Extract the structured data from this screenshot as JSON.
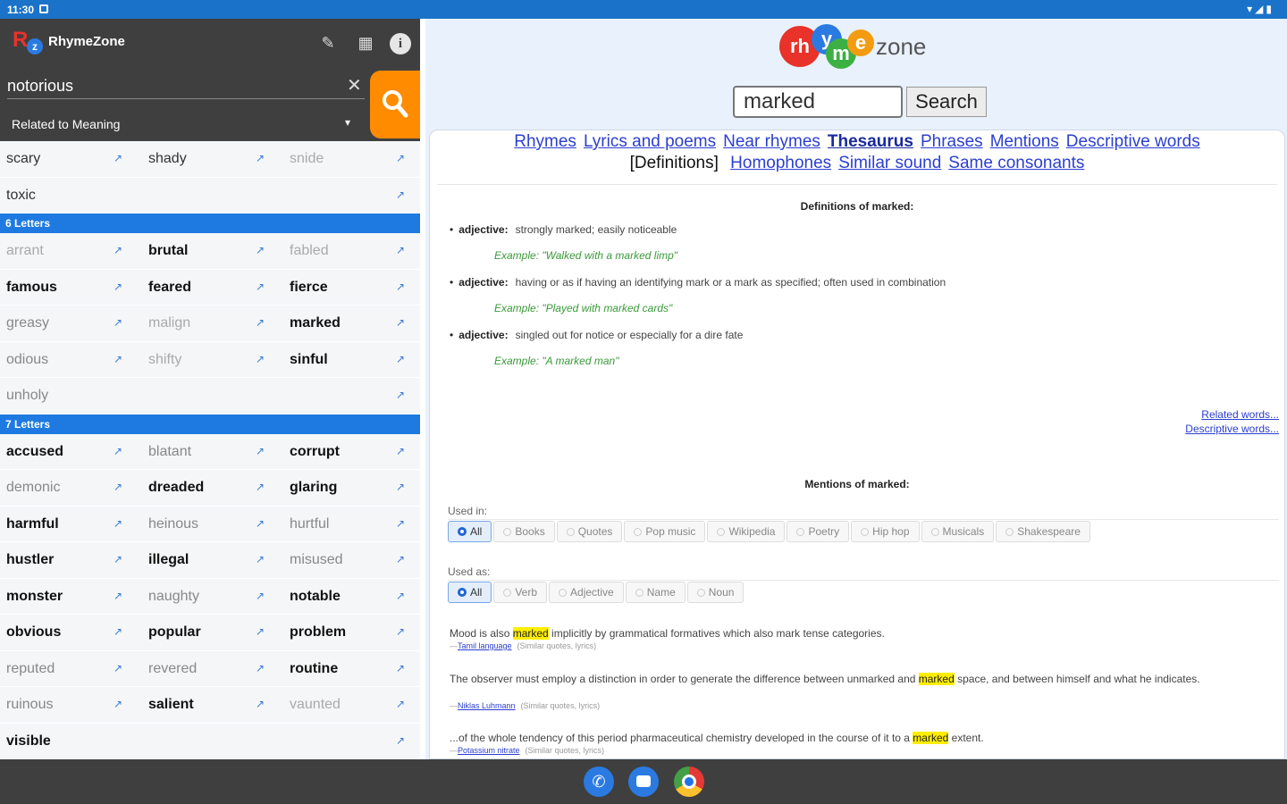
{
  "status_bar": {
    "time": "11:30",
    "icons": "▾◢▮"
  },
  "app": {
    "title": "RhymeZone",
    "query": "notorious",
    "clear": "✕",
    "mode": "Related to Meaning",
    "mode_caret": "▾",
    "icons": {
      "pen": "✎",
      "grid": "▦",
      "info": "i"
    }
  },
  "word_list": {
    "arrow": "↗",
    "top_rows": [
      [
        {
          "w": "scary",
          "s": "mid"
        },
        {
          "w": "shady",
          "s": "mid"
        },
        {
          "w": "snide",
          "s": "faint"
        }
      ],
      [
        {
          "w": "toxic",
          "s": "mid"
        }
      ]
    ],
    "sections": [
      {
        "header": "6 Letters",
        "rows": [
          [
            {
              "w": "arrant",
              "s": "faint"
            },
            {
              "w": "brutal",
              "s": "bold"
            },
            {
              "w": "fabled",
              "s": "faint"
            }
          ],
          [
            {
              "w": "famous",
              "s": "bold"
            },
            {
              "w": "feared",
              "s": "bold"
            },
            {
              "w": "fierce",
              "s": "bold"
            }
          ],
          [
            {
              "w": "greasy",
              "s": "light"
            },
            {
              "w": "malign",
              "s": "faint"
            },
            {
              "w": "marked",
              "s": "bold"
            }
          ],
          [
            {
              "w": "odious",
              "s": "light"
            },
            {
              "w": "shifty",
              "s": "faint"
            },
            {
              "w": "sinful",
              "s": "bold"
            }
          ],
          [
            {
              "w": "unholy",
              "s": "light"
            }
          ]
        ]
      },
      {
        "header": "7 Letters",
        "rows": [
          [
            {
              "w": "accused",
              "s": "bold"
            },
            {
              "w": "blatant",
              "s": "light"
            },
            {
              "w": "corrupt",
              "s": "bold"
            }
          ],
          [
            {
              "w": "demonic",
              "s": "light"
            },
            {
              "w": "dreaded",
              "s": "bold"
            },
            {
              "w": "glaring",
              "s": "bold"
            }
          ],
          [
            {
              "w": "harmful",
              "s": "bold"
            },
            {
              "w": "heinous",
              "s": "light"
            },
            {
              "w": "hurtful",
              "s": "light"
            }
          ],
          [
            {
              "w": "hustler",
              "s": "bold"
            },
            {
              "w": "illegal",
              "s": "bold"
            },
            {
              "w": "misused",
              "s": "light"
            }
          ],
          [
            {
              "w": "monster",
              "s": "bold"
            },
            {
              "w": "naughty",
              "s": "light"
            },
            {
              "w": "notable",
              "s": "bold"
            }
          ],
          [
            {
              "w": "obvious",
              "s": "bold"
            },
            {
              "w": "popular",
              "s": "bold"
            },
            {
              "w": "problem",
              "s": "bold"
            }
          ],
          [
            {
              "w": "reputed",
              "s": "light"
            },
            {
              "w": "revered",
              "s": "light"
            },
            {
              "w": "routine",
              "s": "bold"
            }
          ],
          [
            {
              "w": "ruinous",
              "s": "light"
            },
            {
              "w": "salient",
              "s": "bold"
            },
            {
              "w": "vaunted",
              "s": "faint"
            }
          ],
          [
            {
              "w": "visible",
              "s": "bold"
            }
          ]
        ]
      }
    ]
  },
  "web": {
    "logo_letters": [
      "rh",
      "y",
      "m",
      "e"
    ],
    "logo_zone": "zone",
    "search_value": "marked",
    "search_button": "Search",
    "nav_row1": [
      {
        "label": "Rhymes",
        "current": false
      },
      {
        "label": "Lyrics and poems",
        "current": false
      },
      {
        "label": "Near rhymes",
        "current": false
      },
      {
        "label": "Thesaurus",
        "current": true
      },
      {
        "label": "Phrases",
        "current": false
      },
      {
        "label": "Mentions",
        "current": false
      },
      {
        "label": "Descriptive words",
        "current": false
      }
    ],
    "nav_row2_current": "[Definitions]",
    "nav_row2": [
      "Homophones",
      "Similar sound",
      "Same consonants"
    ],
    "definitions_title": "Definitions of marked:",
    "definitions": [
      {
        "pos": "adjective:",
        "text": "strongly marked; easily noticeable",
        "example": "Example: \"Walked with a marked limp\""
      },
      {
        "pos": "adjective:",
        "text": "having or as if having an identifying mark or a mark as specified; often used in combination",
        "example": "Example: \"Played with marked cards\""
      },
      {
        "pos": "adjective:",
        "text": "singled out for notice or especially for a dire fate",
        "example": "Example: \"A marked man\""
      }
    ],
    "side_links": [
      "Related words...",
      "Descriptive words..."
    ],
    "mentions_title": "Mentions of marked:",
    "used_in_label": "Used in:",
    "used_in": [
      "All",
      "Books",
      "Quotes",
      "Pop music",
      "Wikipedia",
      "Poetry",
      "Hip hop",
      "Musicals",
      "Shakespeare"
    ],
    "used_as_label": "Used as:",
    "used_as": [
      "All",
      "Verb",
      "Adjective",
      "Name",
      "Noun"
    ],
    "quotes": [
      {
        "before": "Mood is also ",
        "hl": "marked",
        "after": " implicitly by grammatical formatives which also mark tense categories.",
        "source": "Tamil language",
        "meta": "(Similar quotes, lyrics)"
      },
      {
        "before": "The observer must employ a distinction in order to generate the difference between unmarked and ",
        "hl": "marked",
        "after": " space, and between himself and what he indicates.",
        "source": "Niklas Luhmann",
        "meta": "(Similar quotes, lyrics)"
      },
      {
        "before": "...of the whole tendency of this period pharmaceutical chemistry developed in the course of it to a ",
        "hl": "marked",
        "after": " extent.",
        "source": "Potassium nitrate",
        "meta": "(Similar quotes, lyrics)"
      }
    ]
  },
  "colors": {
    "status_bar": "#1a73c8",
    "app_bar": "#3f3f3f",
    "accent_orange": "#ff8c00",
    "section_blue": "#1e7ae0",
    "link_blue": "#2b3fcf",
    "highlight": "#ffee00"
  }
}
